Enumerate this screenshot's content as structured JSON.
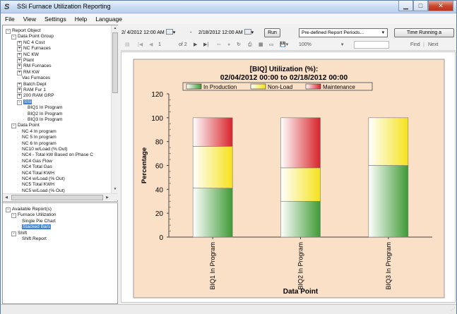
{
  "window": {
    "title": "SSi Furnace Utilization Reporting",
    "app_icon": "app-logo-icon"
  },
  "menu": [
    "File",
    "View",
    "Settings",
    "Help",
    "Language"
  ],
  "tree": [
    {
      "label": "Report Object",
      "level": 0,
      "exp": "-"
    },
    {
      "label": "Data Point Group",
      "level": 1,
      "exp": "-"
    },
    {
      "label": "NC 4 Cost",
      "level": 2,
      "exp": "+"
    },
    {
      "label": "NC Furnaces",
      "level": 2,
      "exp": "+"
    },
    {
      "label": "NC KW",
      "level": 2,
      "exp": "+"
    },
    {
      "label": "Plant",
      "level": 2,
      "exp": "+"
    },
    {
      "label": "RM Furnaces",
      "level": 2,
      "exp": "+"
    },
    {
      "label": "RM KW",
      "level": 2,
      "exp": "+"
    },
    {
      "label": "Vac Furnaces",
      "level": 2,
      "exp": ""
    },
    {
      "label": "Batch Dept",
      "level": 2,
      "exp": "+"
    },
    {
      "label": "RAM Fur 1",
      "level": 2,
      "exp": "+"
    },
    {
      "label": "200 RAM GRP",
      "level": 2,
      "exp": "+"
    },
    {
      "label": "SSi",
      "level": 2,
      "exp": "-",
      "selected": true
    },
    {
      "label": "BIQ1 In Program",
      "level": 3,
      "exp": ""
    },
    {
      "label": "BIQ2 In Program",
      "level": 3,
      "exp": ""
    },
    {
      "label": "BIQ3 In Program",
      "level": 3,
      "exp": ""
    },
    {
      "label": "Data Point",
      "level": 1,
      "exp": "-"
    },
    {
      "label": "NC 4 In program",
      "level": 2,
      "exp": ""
    },
    {
      "label": "NC 5 In program",
      "level": 2,
      "exp": ""
    },
    {
      "label": "NC 6 In program",
      "level": 2,
      "exp": ""
    },
    {
      "label": "NC10 w/Load (% Out)",
      "level": 2,
      "exp": ""
    },
    {
      "label": "NC4 - Total kW Based on Phase C",
      "level": 2,
      "exp": ""
    },
    {
      "label": "NC4 Gas Flow",
      "level": 2,
      "exp": ""
    },
    {
      "label": "NC4 Total Gas",
      "level": 2,
      "exp": ""
    },
    {
      "label": "NC4 Total KWH",
      "level": 2,
      "exp": ""
    },
    {
      "label": "NC4 w/Load (% Out)",
      "level": 2,
      "exp": ""
    },
    {
      "label": "NC5 Total KWH",
      "level": 2,
      "exp": ""
    },
    {
      "label": "NC5 w/Load (% Out)",
      "level": 2,
      "exp": ""
    }
  ],
  "reports_tree": [
    {
      "label": "Available Report(s)",
      "level": 0,
      "exp": "-"
    },
    {
      "label": "Furnace Utilization",
      "level": 1,
      "exp": "-"
    },
    {
      "label": "Single Pie Chart",
      "level": 2,
      "exp": ""
    },
    {
      "label": "Stacked Bars",
      "level": 2,
      "exp": "",
      "selected": true
    },
    {
      "label": "Shift",
      "level": 1,
      "exp": "-"
    },
    {
      "label": "Shift Report",
      "level": 2,
      "exp": ""
    }
  ],
  "toolbar": {
    "start_date": "2/ 4/2012 12:00 AM",
    "dash": "-",
    "end_date": "2/18/2012 12:00 AM",
    "run_label": "Run",
    "predefined_label": "Pre-defined Report Periods...",
    "time_running_label": "Time Running a"
  },
  "viewer": {
    "page_current": "1",
    "page_of": "of 2",
    "zoom": "100%",
    "find_label": "Find",
    "separator": "|",
    "next_label": "Next"
  },
  "chart_data": {
    "type": "bar",
    "stacked": true,
    "title_line1": "[BIQ] Utilization (%):",
    "title_line2": "02/04/2012 00:00 to 02/18/2012 00:00",
    "categories": [
      "BIQ1 In Program",
      "BIQ2 In Program",
      "BIQ3 In Program"
    ],
    "series": [
      {
        "name": "In Production",
        "values": [
          41,
          30,
          60
        ],
        "color": "#3e9a35"
      },
      {
        "name": "Non-Load",
        "values": [
          35,
          28,
          40
        ],
        "color": "#f5e21a"
      },
      {
        "name": "Maintenance",
        "values": [
          24,
          42,
          0
        ],
        "color": "#d8232a"
      }
    ],
    "ylim": [
      0,
      120
    ],
    "yticks": [
      "0",
      "20",
      "40",
      "60",
      "80",
      "100",
      "120"
    ],
    "ylabel": "Percentage",
    "xlabel": "Data Point",
    "legend_position": "top",
    "plot_background": "#fbe0c8",
    "grid": false
  }
}
